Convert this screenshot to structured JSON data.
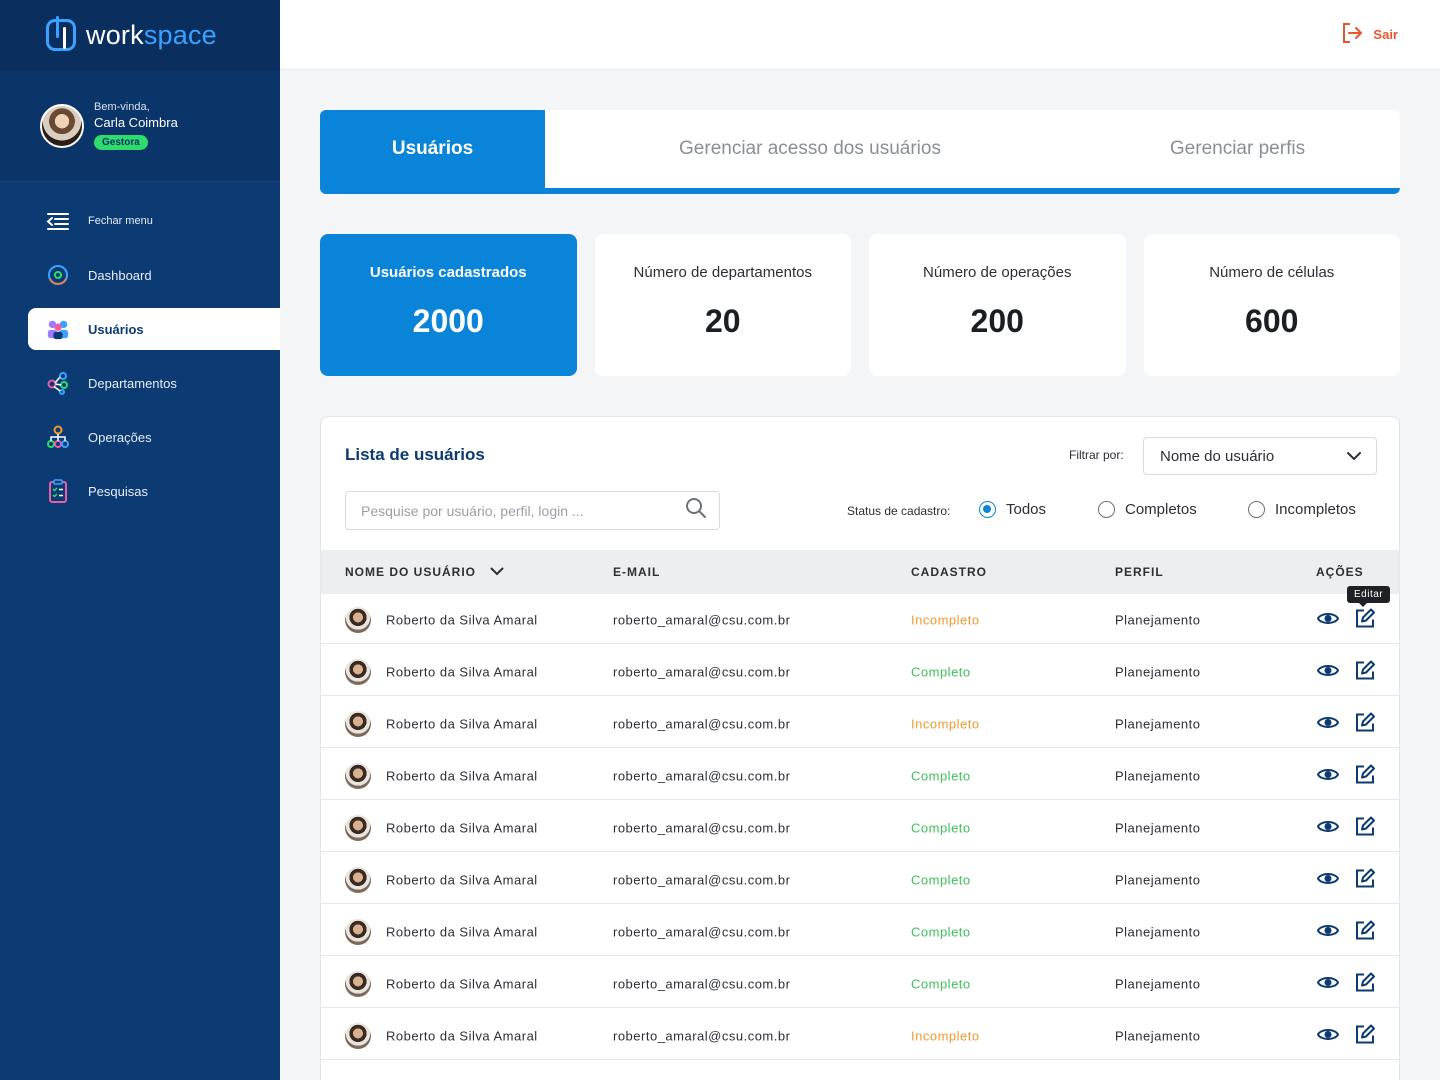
{
  "app": {
    "logo_text_1": "work",
    "logo_text_2": "space"
  },
  "user": {
    "greeting": "Bem-vinda,",
    "name": "Carla Coimbra",
    "role": "Gestora"
  },
  "menu": [
    {
      "label": "Fechar menu",
      "icon": "menu-collapse-icon"
    },
    {
      "label": "Dashboard",
      "icon": "dashboard-gauge-icon"
    },
    {
      "label": "Usuários",
      "icon": "users-group-icon",
      "active": true
    },
    {
      "label": "Departamentos",
      "icon": "departments-network-icon"
    },
    {
      "label": "Operações",
      "icon": "operations-tree-icon"
    },
    {
      "label": "Pesquisas",
      "icon": "clipboard-checklist-icon"
    }
  ],
  "topbar": {
    "logout_label": "Sair"
  },
  "tabs": [
    {
      "label": "Usuários",
      "active": true
    },
    {
      "label": "Gerenciar acesso dos usuários"
    },
    {
      "label": "Gerenciar perfis"
    }
  ],
  "stats": [
    {
      "label": "Usuários cadastrados",
      "value": "2000"
    },
    {
      "label": "Número de departamentos",
      "value": "20"
    },
    {
      "label": "Número de operações",
      "value": "200"
    },
    {
      "label": "Número de células",
      "value": "600"
    }
  ],
  "list": {
    "title": "Lista de usuários",
    "filter_label": "Filtrar por:",
    "filter_value": "Nome do usuário",
    "search_placeholder": "Pesquise por usuário, perfil, login ...",
    "status_label": "Status de cadastro:",
    "status_options": [
      "Todos",
      "Completos",
      "Incompletos"
    ],
    "status_selected": "Todos",
    "columns": [
      "NOME DO USUÁRIO",
      "E-MAIL",
      "CADASTRO",
      "PERFIL",
      "AÇÕES"
    ],
    "tooltip": "Editar",
    "rows": [
      {
        "name": "Roberto da Silva Amaral",
        "email": "roberto_amaral@csu.com.br",
        "status": "Incompleto",
        "profile": "Planejamento"
      },
      {
        "name": "Roberto da Silva Amaral",
        "email": "roberto_amaral@csu.com.br",
        "status": "Completo",
        "profile": "Planejamento"
      },
      {
        "name": "Roberto da Silva Amaral",
        "email": "roberto_amaral@csu.com.br",
        "status": "Incompleto",
        "profile": "Planejamento"
      },
      {
        "name": "Roberto da Silva Amaral",
        "email": "roberto_amaral@csu.com.br",
        "status": "Completo",
        "profile": "Planejamento"
      },
      {
        "name": "Roberto da Silva Amaral",
        "email": "roberto_amaral@csu.com.br",
        "status": "Completo",
        "profile": "Planejamento"
      },
      {
        "name": "Roberto da Silva Amaral",
        "email": "roberto_amaral@csu.com.br",
        "status": "Completo",
        "profile": "Planejamento"
      },
      {
        "name": "Roberto da Silva Amaral",
        "email": "roberto_amaral@csu.com.br",
        "status": "Completo",
        "profile": "Planejamento"
      },
      {
        "name": "Roberto da Silva Amaral",
        "email": "roberto_amaral@csu.com.br",
        "status": "Completo",
        "profile": "Planejamento"
      },
      {
        "name": "Roberto da Silva Amaral",
        "email": "roberto_amaral@csu.com.br",
        "status": "Incompleto",
        "profile": "Planejamento"
      }
    ]
  },
  "colors": {
    "sidebar": "#0c3a73",
    "primary": "#0a84d8",
    "logout": "#e8552f",
    "incomplete": "#ef9a2e",
    "complete": "#3fc15a",
    "badge": "#2ddc6a"
  }
}
